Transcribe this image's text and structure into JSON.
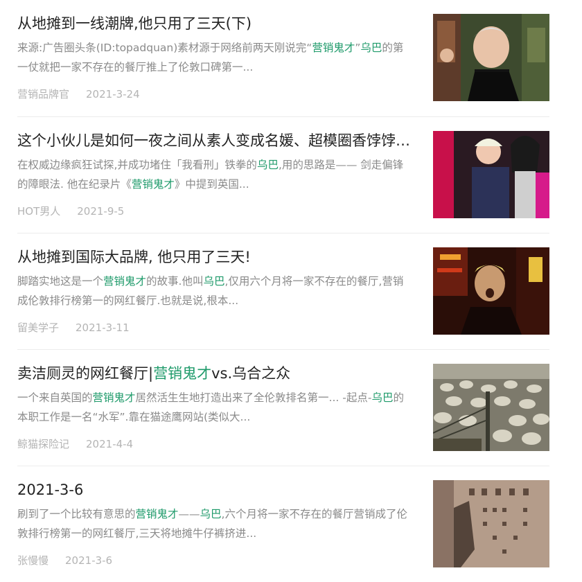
{
  "articles": [
    {
      "title_parts": [
        "从地摊到一线潮牌,他只用了三天(下)"
      ],
      "snippet_parts": [
        {
          "t": "来源:广告圈头条(ID:topadquan)素材源于网络前两天刚说完“",
          "h": false
        },
        {
          "t": "营销鬼才",
          "h": true
        },
        {
          "t": "”",
          "h": false
        },
        {
          "t": "乌巴",
          "h": true
        },
        {
          "t": "的第一仗就把一家不存在的餐厅推上了伦敦口碑第一...",
          "h": false
        }
      ],
      "author": "营销品牌官",
      "date": "2021-3-24",
      "thumb_icon": "portrait-photo-icon"
    },
    {
      "title_parts": [
        "这个小伙儿是如何一夜之间从素人变成名媛、超模圈香饽饽的？"
      ],
      "snippet_parts": [
        {
          "t": "在权威边缘疯狂试探,并成功堵住「我看刑」铁拳的",
          "h": false
        },
        {
          "t": "乌巴",
          "h": true
        },
        {
          "t": ",用的思路是—— 剑走偏锋的障眼法. 他在纪录片《",
          "h": false
        },
        {
          "t": "营销鬼才",
          "h": true
        },
        {
          "t": "》中提到英国...",
          "h": false
        }
      ],
      "author": "HOT男人",
      "date": "2021-9-5",
      "thumb_icon": "fashion-photo-icon"
    },
    {
      "title_parts": [
        "从地摊到国际大品牌, 他只用了三天!"
      ],
      "snippet_parts": [
        {
          "t": "脚踏实地这是一个",
          "h": false
        },
        {
          "t": "营销鬼才",
          "h": true
        },
        {
          "t": "的故事.他叫",
          "h": false
        },
        {
          "t": "乌巴",
          "h": true
        },
        {
          "t": ",仅用六个月将一家不存在的餐厅,营销成伦敦排行榜第一的网红餐厅.也就是说,根本...",
          "h": false
        }
      ],
      "author": "留美学子",
      "date": "2021-3-11",
      "thumb_icon": "night-street-photo-icon"
    },
    {
      "title_parts": [
        "卖洁厕灵的网红餐厅|",
        "营销鬼才",
        "vs.乌合之众"
      ],
      "snippet_parts": [
        {
          "t": "一个来自英国的",
          "h": false
        },
        {
          "t": "营销鬼才",
          "h": true
        },
        {
          "t": "居然活生生地打造出来了全伦敦排名第一... -起点-",
          "h": false
        },
        {
          "t": "乌巴",
          "h": true
        },
        {
          "t": "的本职工作是一名“水军”.靠在猫途鹰网站(类似大...",
          "h": false
        }
      ],
      "author": "鲸猫探险记",
      "date": "2021-4-4",
      "thumb_icon": "sheep-flock-photo-icon"
    },
    {
      "title_parts": [
        "2021-3-6"
      ],
      "snippet_parts": [
        {
          "t": "刷到了一个比较有意思的",
          "h": false
        },
        {
          "t": "营销鬼才",
          "h": true
        },
        {
          "t": "——",
          "h": false
        },
        {
          "t": "乌巴",
          "h": true
        },
        {
          "t": ",六个月将一家不存在的餐厅营销成了伦敦排行榜第一的网红餐厅,三天将地摊牛仔裤挤进...",
          "h": false
        }
      ],
      "author": "张慢慢",
      "date": "2021-3-6",
      "thumb_icon": "stone-stele-photo-icon"
    }
  ],
  "colors": {
    "title": "#222222",
    "snippet": "#8a8a8a",
    "highlight": "#1e9a6a",
    "meta": "#b4b4b4",
    "divider": "#ececec"
  }
}
